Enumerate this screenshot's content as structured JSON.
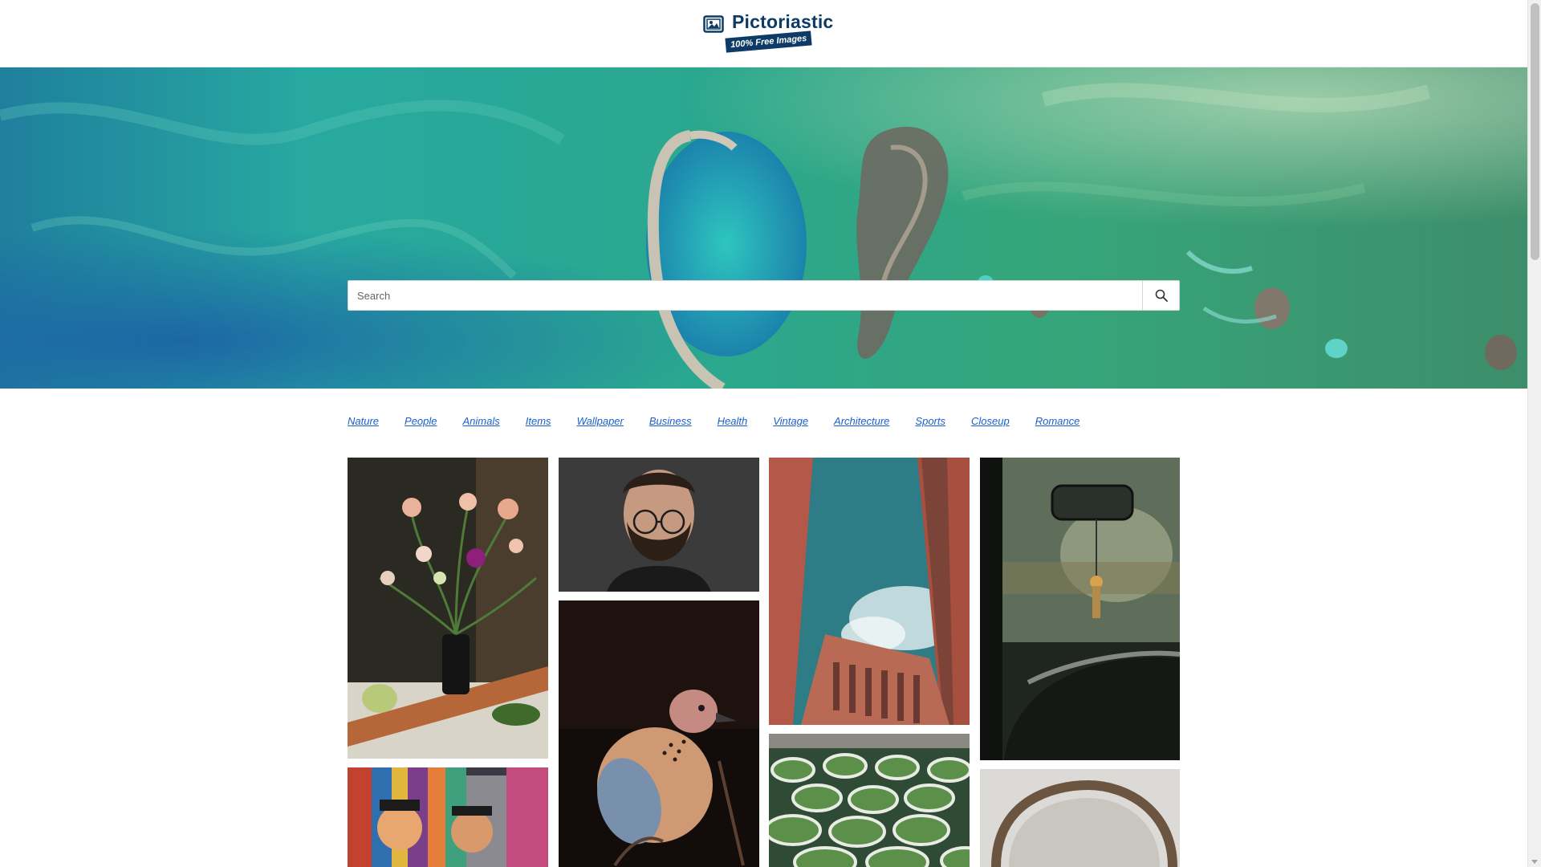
{
  "header": {
    "logo_title": "Pictoriastic",
    "logo_badge": "100% Free Images",
    "logo_icon": "picture-frame-icon"
  },
  "search": {
    "placeholder": "Search",
    "value": "",
    "icon": "search-icon"
  },
  "categories": [
    "Nature",
    "People",
    "Animals",
    "Items",
    "Wallpaper",
    "Business",
    "Health",
    "Vintage",
    "Architecture",
    "Sports",
    "Closeup",
    "Romance"
  ],
  "colors": {
    "brand": "#0d3b66",
    "link": "#1a5fd0",
    "hero_teal": "#1fa38f"
  }
}
